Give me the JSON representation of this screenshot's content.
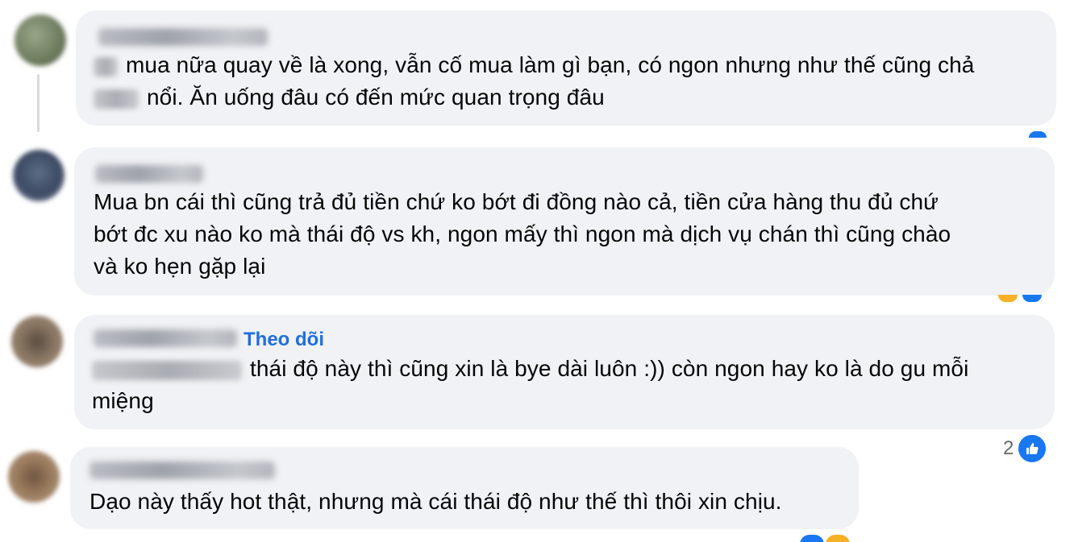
{
  "comments": [
    {
      "text_line1": "mua nữa quay về là xong, vẫn cố mua làm gì bạn, có ngon nhưng như thế cũng chả",
      "text_line2": "nổi. Ăn uống đâu có đến mức quan trọng đâu"
    },
    {
      "text_line1": "Mua bn cái thì cũng trả đủ tiền chứ ko bớt đi đồng nào cả, tiền cửa hàng thu đủ chứ",
      "text_line2": "bớt đc xu nào ko mà thái độ vs kh, ngon mấy thì ngon mà dịch vụ chán thì cũng chào",
      "text_line3": "và ko hẹn gặp lại"
    },
    {
      "follow_label": "Theo dõi",
      "text_line1": "thái độ này thì cũng xin là bye dài luôn :)) còn ngon hay ko là do gu mỗi",
      "text_line2": "miệng",
      "reaction_count": "2"
    },
    {
      "text_line1": "Dạo này thấy hot thật, nhưng mà cái thái độ như thế thì thôi xin chịu."
    }
  ],
  "icons": {
    "like": "like-thumb-icon",
    "haha": "haha-emoji-icon"
  },
  "colors": {
    "bubble": "#f0f2f5",
    "link": "#216fdb",
    "like": "#1877f2",
    "haha": "#f7b125"
  }
}
